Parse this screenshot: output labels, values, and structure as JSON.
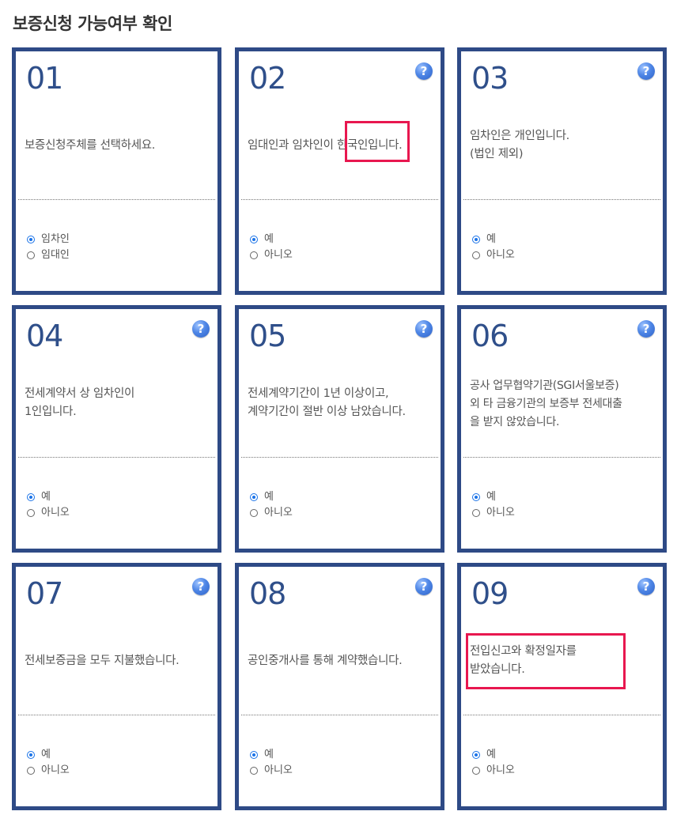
{
  "page": {
    "title": "보증신청 가능여부 확인"
  },
  "cards": [
    {
      "num": "01",
      "help": "",
      "question_lines": [
        "보증신청주체를 선택하세요."
      ],
      "options": [
        "임차인",
        "임대인"
      ],
      "selected": 0
    },
    {
      "num": "02",
      "help": "?",
      "question_lines": [
        "임대인과 임차인이 한국인입니다."
      ],
      "options": [
        "예",
        "아니오"
      ],
      "selected": 0
    },
    {
      "num": "03",
      "help": "?",
      "question_lines": [
        "임차인은 개인입니다.",
        "(법인 제외)"
      ],
      "options": [
        "예",
        "아니오"
      ],
      "selected": 0
    },
    {
      "num": "04",
      "help": "?",
      "question_lines": [
        "전세계약서 상 임차인이",
        "1인입니다."
      ],
      "options": [
        "예",
        "아니오"
      ],
      "selected": 0
    },
    {
      "num": "05",
      "help": "?",
      "question_lines": [
        "전세계약기간이 1년 이상이고,",
        "계약기간이 절반 이상 남았습니다."
      ],
      "options": [
        "예",
        "아니오"
      ],
      "selected": 0
    },
    {
      "num": "06",
      "help": "?",
      "question_lines": [
        "공사 업무협약기관(SGI서울보증)",
        "외 타 금융기관의 보증부 전세대출",
        "을 받지 않았습니다."
      ],
      "options": [
        "예",
        "아니오"
      ],
      "selected": 0
    },
    {
      "num": "07",
      "help": "?",
      "question_lines": [
        "전세보증금을 모두 지불했습니다."
      ],
      "options": [
        "예",
        "아니오"
      ],
      "selected": 0
    },
    {
      "num": "08",
      "help": "?",
      "question_lines": [
        "공인중개사를 통해 계약했습니다."
      ],
      "options": [
        "예",
        "아니오"
      ],
      "selected": 0
    },
    {
      "num": "09",
      "help": "?",
      "question_lines": [
        "전입신고와 확정일자를",
        "받았습니다."
      ],
      "options": [
        "예",
        "아니오"
      ],
      "selected": 0
    }
  ],
  "colors": {
    "border": "#2e4a86",
    "number": "#2f4f8a",
    "highlight": "#e8174f",
    "radio": "#1a73e8"
  }
}
